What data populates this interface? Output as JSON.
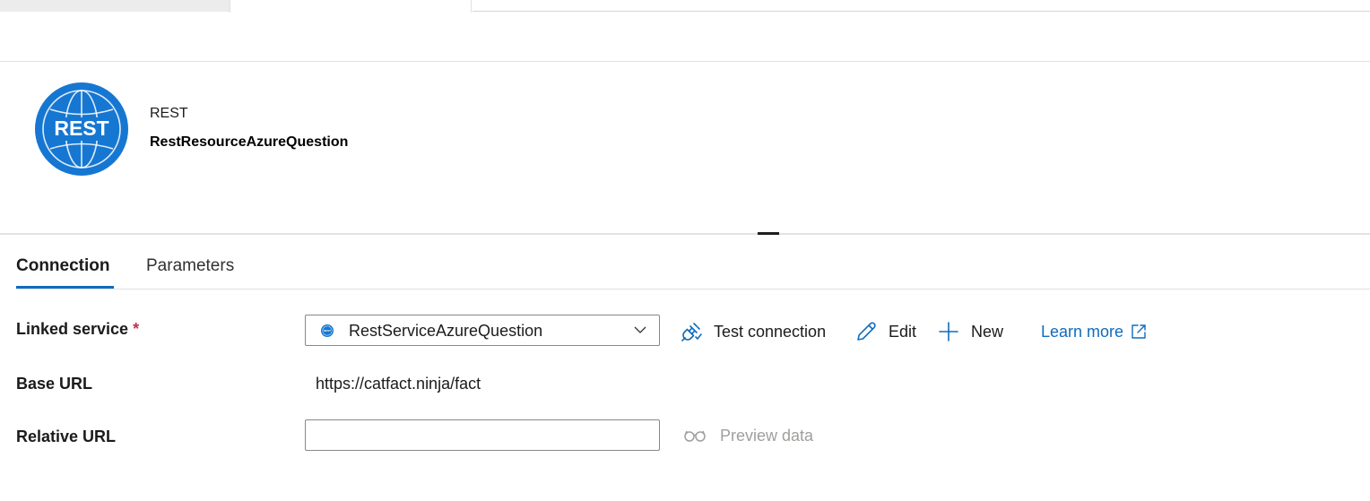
{
  "header": {
    "icon_text": "REST",
    "type_label": "REST",
    "resource_name": "RestResourceAzureQuestion"
  },
  "tabs": [
    {
      "label": "Connection",
      "active": true
    },
    {
      "label": "Parameters",
      "active": false
    }
  ],
  "form": {
    "linked_service": {
      "label": "Linked service",
      "required_mark": "*",
      "value": "RestServiceAzureQuestion",
      "icon": "rest-service-icon"
    },
    "actions": {
      "test_connection": "Test connection",
      "edit": "Edit",
      "new": "New",
      "learn_more": "Learn more"
    },
    "base_url": {
      "label": "Base URL",
      "value": "https://catfact.ninja/fact"
    },
    "relative_url": {
      "label": "Relative URL",
      "value": "",
      "preview_label": "Preview data"
    }
  },
  "colors": {
    "accent": "#0f6cbd",
    "rest_icon_blue": "#1677d2",
    "required": "#c4314b",
    "disabled_text": "#a19f9d"
  }
}
